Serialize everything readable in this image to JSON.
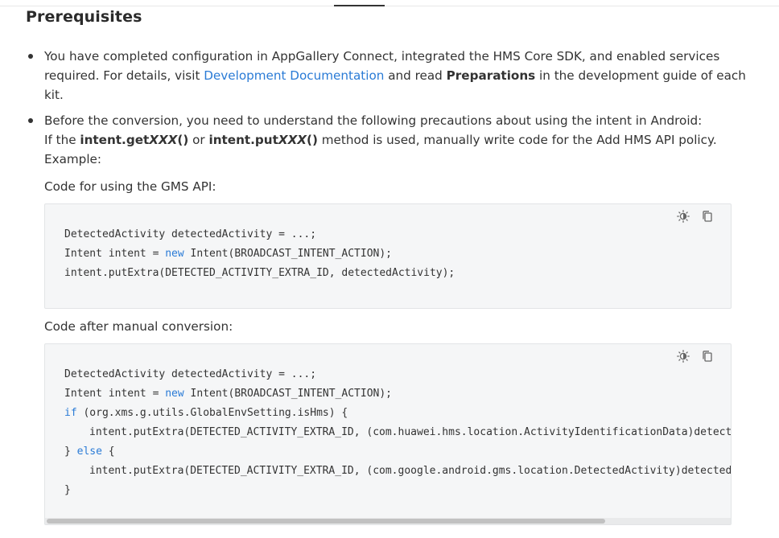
{
  "section": {
    "title": "Prerequisites"
  },
  "bullet1": {
    "text_a": "You have completed configuration in AppGallery Connect, integrated the HMS Core SDK, and enabled services required. For details, visit ",
    "link": "Development Documentation",
    "text_b": " and read ",
    "bold": "Preparations",
    "text_c": " in the development guide of each kit."
  },
  "bullet2": {
    "line1": "Before the conversion, you need to understand the following precautions about using the intent in Android:",
    "if_label": "If the ",
    "get_a": "intent.get",
    "get_b": "XXX",
    "get_c": "()",
    "or": " or ",
    "put_a": "intent.put",
    "put_b": "XXX",
    "put_c": "()",
    "rest": " method is used, manually write code for the Add HMS API policy.",
    "example": "Example:",
    "label_gms": "Code for using the GMS API:",
    "label_after": "Code after manual conversion:"
  },
  "code_gms": {
    "l1": "DetectedActivity detectedActivity = ...;",
    "l2_a": "Intent intent = ",
    "l2_kw": "new",
    "l2_b": " Intent(BROADCAST_INTENT_ACTION);",
    "l3": "intent.putExtra(DETECTED_ACTIVITY_EXTRA_ID, detectedActivity);"
  },
  "code_after": {
    "l1": "DetectedActivity detectedActivity = ...;",
    "l2_a": "Intent intent = ",
    "l2_kw": "new",
    "l2_b": " Intent(BROADCAST_INTENT_ACTION);",
    "l3_kw": "if",
    "l3_b": " (org.xms.g.utils.GlobalEnvSetting.isHms) {",
    "l4": "intent.putExtra(DETECTED_ACTIVITY_EXTRA_ID, (com.huawei.hms.location.ActivityIdentificationData)detected",
    "l5_a": "} ",
    "l5_kw": "else",
    "l5_b": " {",
    "l6": "intent.putExtra(DETECTED_ACTIVITY_EXTRA_ID, (com.google.android.gms.location.DetectedActivity)detectedAc",
    "l7": "}"
  },
  "icons": {
    "theme": "theme-toggle-icon",
    "copy": "copy-icon"
  },
  "colors": {
    "link": "#2a7bd6",
    "code_bg": "#f5f6f7",
    "text": "#333333"
  }
}
